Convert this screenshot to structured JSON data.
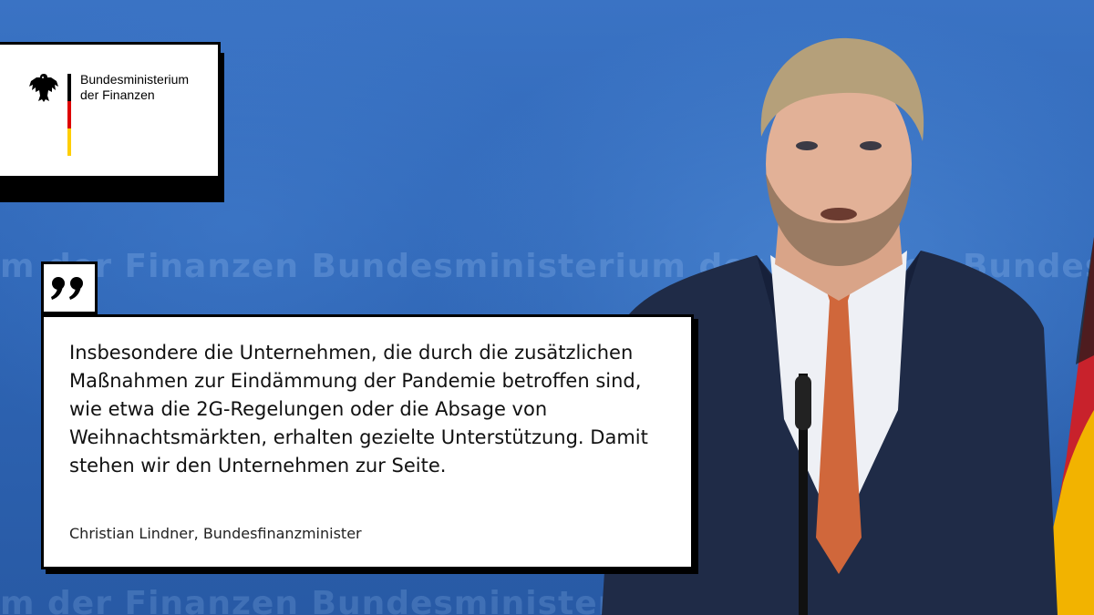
{
  "logo": {
    "line1": "Bundesministerium",
    "line2": "der Finanzen",
    "icon": "federal-eagle-icon"
  },
  "quote": {
    "icon": "quotation-mark-icon",
    "text": "Insbesondere die Unternehmen, die durch die zusätzlichen Maßnahmen zur Eindämmung der Pandemie betroffen sind, wie etwa die 2G-Regelungen oder die Absage von Weihnachtsmärkten, erhalten gezielte Unterstützung. Damit stehen wir den Unternehmen zur Seite.",
    "author": "Christian Lindner, Bundesfinanzminister"
  },
  "backdrop": {
    "row1": "ium der Finanzen Bundesministerium der Finanzen Bundesministerium",
    "row3": "ium der Finanzen Bundesministerium der Finanzen"
  },
  "colors": {
    "background": "#2f66b6",
    "flag_black": "#000000",
    "flag_red": "#dd0000",
    "flag_gold": "#ffce00",
    "card": "#ffffff"
  }
}
